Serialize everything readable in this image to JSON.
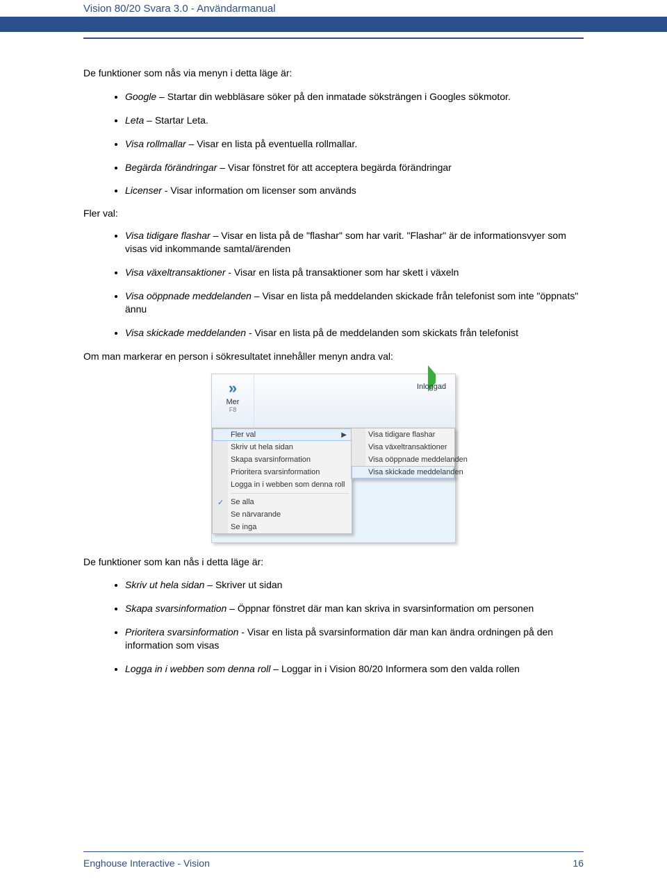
{
  "header": {
    "title": "Vision 80/20 Svara 3.0 - Användarmanual"
  },
  "intro": "De funktioner som nås via menyn i detta läge är:",
  "list1": [
    {
      "term": "Google",
      "desc": " – Startar din webbläsare söker på den inmatade söksträngen i Googles sökmotor."
    },
    {
      "term": "Leta",
      "desc": " – Startar Leta."
    },
    {
      "term": "Visa rollmallar",
      "desc": " – Visar en lista på eventuella rollmallar."
    },
    {
      "term": "Begärda förändringar",
      "desc": " – Visar fönstret för att acceptera begärda förändringar"
    },
    {
      "term": "Licenser",
      "desc": " - Visar information om licenser som används"
    }
  ],
  "subhead1": "Fler val:",
  "list2": [
    {
      "term": "Visa tidigare flashar",
      "desc": " – Visar en lista på de \"flashar\" som har varit. \"Flashar\" är de informationsvyer som visas vid inkommande samtal/ärenden"
    },
    {
      "term": "Visa växeltransaktioner",
      "desc": " - Visar en lista på transaktioner som har skett i växeln"
    },
    {
      "term": "Visa oöppnade meddelanden",
      "desc": " – Visar en lista på meddelanden skickade från telefonist som inte \"öppnats\" ännu"
    },
    {
      "term": "Visa skickade meddelanden",
      "desc": " - Visar en lista på de meddelanden som skickats från telefonist"
    }
  ],
  "para2": "Om man markerar en person i sökresultatet innehåller menyn andra val:",
  "shot": {
    "mer_label": "Mer",
    "mer_sub": "F8",
    "inloggad_label": "Inloggad",
    "menu": {
      "flerval": "Fler val",
      "skrivut": "Skriv ut hela sidan",
      "skapa": "Skapa svarsinformation",
      "prio": "Prioritera svarsinformation",
      "logga": "Logga in i webben som denna roll",
      "sealla": "Se alla",
      "senar": "Se närvarande",
      "seinga": "Se inga"
    },
    "submenu": {
      "s1": "Visa tidigare flashar",
      "s2": "Visa växeltransaktioner",
      "s3": "Visa oöppnade meddelanden",
      "s4": "Visa skickade meddelanden"
    }
  },
  "para3": "De funktioner som kan nås i detta läge är:",
  "list3": [
    {
      "term": "Skriv ut hela sidan",
      "desc": " – Skriver ut sidan"
    },
    {
      "term": "Skapa svarsinformation",
      "desc": " – Öppnar fönstret där man kan skriva in svarsinformation om personen"
    },
    {
      "term": "Prioritera svarsinformation",
      "desc": " - Visar en lista på svarsinformation där man kan ändra ordningen på den information som visas"
    },
    {
      "term": "Logga in i webben som denna roll",
      "desc": " – Loggar in i Vision 80/20 Informera som den valda rollen"
    }
  ],
  "footer": {
    "left": "Enghouse Interactive - Vision",
    "page": "16"
  }
}
